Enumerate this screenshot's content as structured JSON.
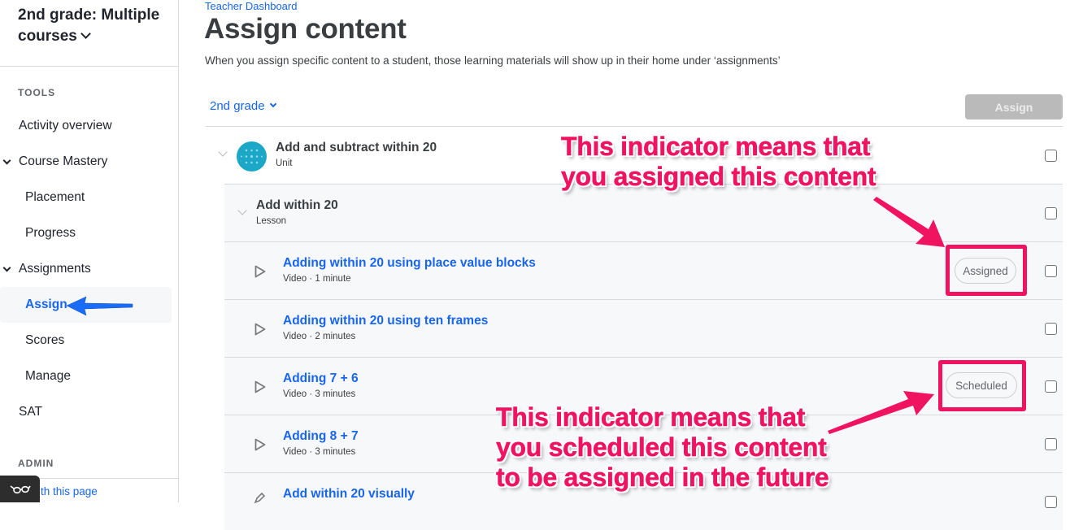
{
  "sidebar": {
    "course_title": "2nd grade: Multiple courses",
    "sections": {
      "tools": "TOOLS",
      "admin": "ADMIN"
    },
    "items": [
      {
        "label": "Activity overview"
      },
      {
        "label": "Course Mastery"
      },
      {
        "label": "Placement"
      },
      {
        "label": "Progress"
      },
      {
        "label": "Assignments"
      },
      {
        "label": "Assign"
      },
      {
        "label": "Scores"
      },
      {
        "label": "Manage"
      },
      {
        "label": "SAT"
      }
    ],
    "help_link": "th this page"
  },
  "header": {
    "breadcrumb": "Teacher Dashboard",
    "title": "Assign content",
    "description": "When you assign specific content to a student, those learning materials will show up in their home under ‘assignments’"
  },
  "toolbar": {
    "grade_select": "2nd grade",
    "assign_label": "Assign"
  },
  "content": {
    "unit": {
      "title": "Add and subtract within 20",
      "type": "Unit"
    },
    "lesson": {
      "title": "Add within 20",
      "type": "Lesson"
    },
    "items": [
      {
        "title": "Adding within 20 using place value blocks",
        "meta": "Video · 1 minute",
        "status": "Assigned"
      },
      {
        "title": "Adding within 20 using ten frames",
        "meta": "Video · 2 minutes",
        "status": ""
      },
      {
        "title": "Adding 7 + 6",
        "meta": "Video · 3 minutes",
        "status": "Scheduled"
      },
      {
        "title": "Adding 8 + 7",
        "meta": "Video · 3 minutes",
        "status": ""
      },
      {
        "title": "Add within 20 visually",
        "meta": "",
        "status": ""
      }
    ]
  },
  "annotations": {
    "assigned": [
      "This indicator means that",
      "you assigned this content"
    ],
    "scheduled": [
      "This indicator means that",
      "you scheduled this content",
      "to be assigned in the future"
    ],
    "highlight_color": "#f0135f",
    "arrow_color": "#1865f2"
  }
}
